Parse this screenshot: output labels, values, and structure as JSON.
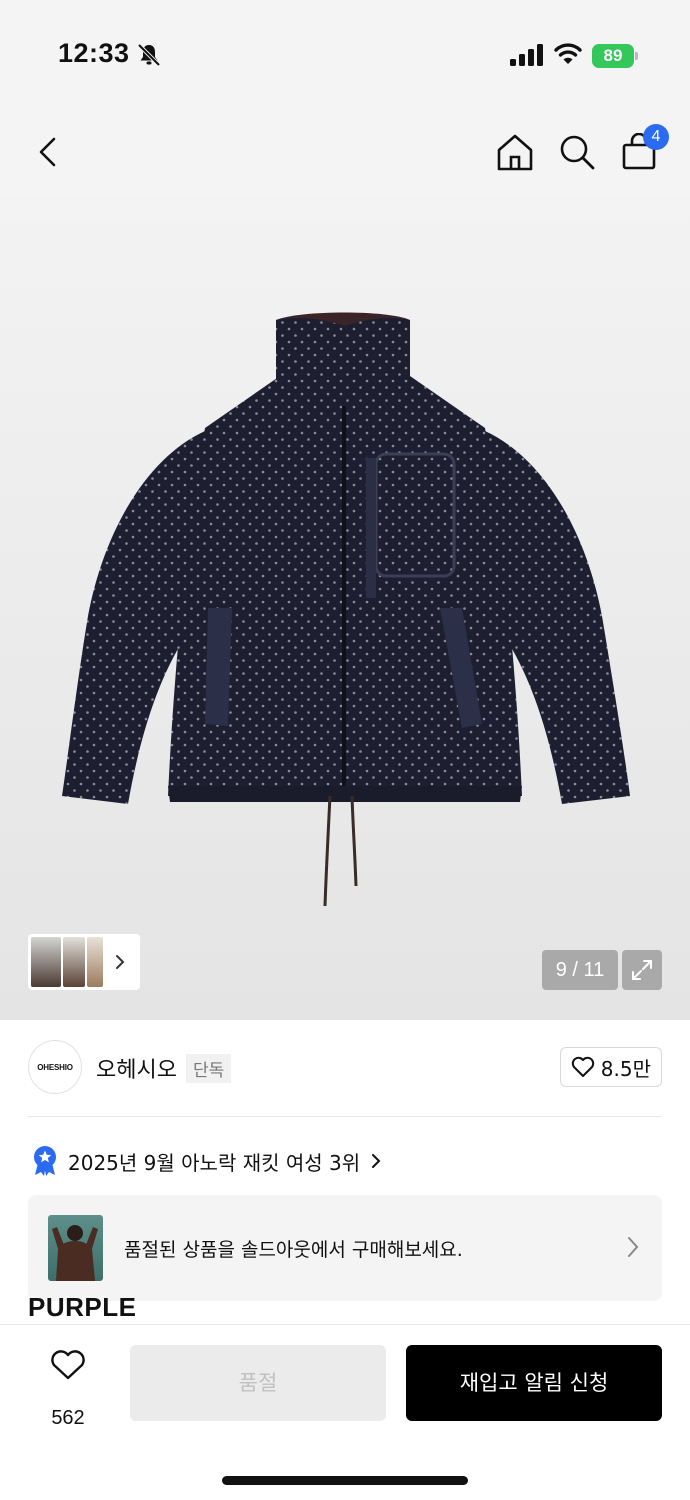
{
  "status_bar": {
    "time": "12:33",
    "battery": "89"
  },
  "nav": {
    "icons": [
      "back-icon",
      "home-icon",
      "search-icon",
      "bag-icon"
    ],
    "cart_badge": "4"
  },
  "gallery": {
    "page_indicator": "9 / 11",
    "current_page": 9,
    "total_pages": 11,
    "product_image": "navy polka-dot fleece jacket with drawstring hem"
  },
  "brand": {
    "logo_text": "OHESHIO",
    "name": "오헤시오",
    "tag": "단독",
    "like_count": "8.5만"
  },
  "ranking": {
    "text": "2025년 9월 아노락 재킷 여성 3위"
  },
  "banner": {
    "text": "품절된 상품을 솔드아웃에서 구매해보세요."
  },
  "product": {
    "name_partial": "PURPLE"
  },
  "bottom_bar": {
    "wish_count": "562",
    "soldout_label": "품절",
    "restock_label": "재입고 알림 신청"
  },
  "colors": {
    "accent_blue": "#2a6bf2",
    "battery_green": "#34c759",
    "primary_button": "#000000"
  }
}
